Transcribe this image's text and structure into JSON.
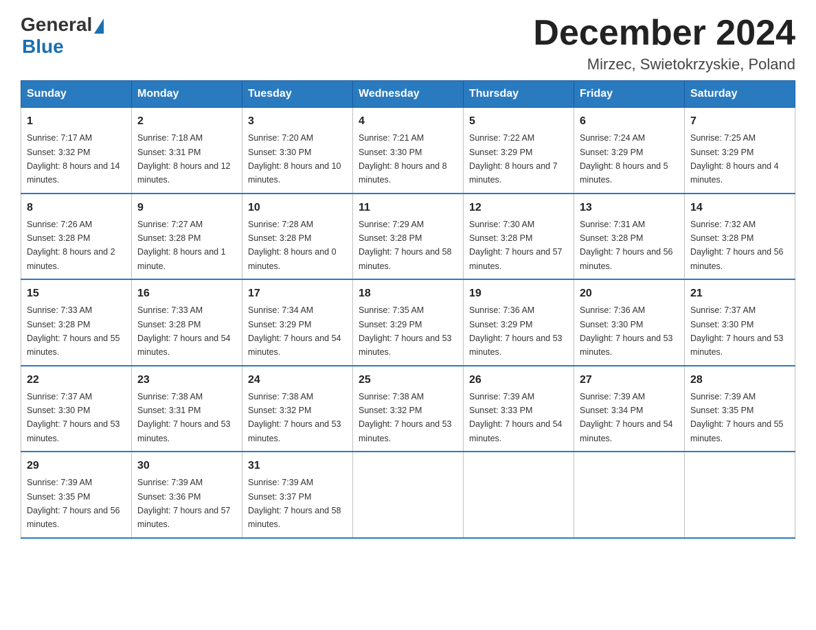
{
  "logo": {
    "general": "General",
    "blue": "Blue"
  },
  "title": "December 2024",
  "location": "Mirzec, Swietokrzyskie, Poland",
  "days_of_week": [
    "Sunday",
    "Monday",
    "Tuesday",
    "Wednesday",
    "Thursday",
    "Friday",
    "Saturday"
  ],
  "weeks": [
    [
      {
        "day": "1",
        "sunrise": "7:17 AM",
        "sunset": "3:32 PM",
        "daylight": "8 hours and 14 minutes."
      },
      {
        "day": "2",
        "sunrise": "7:18 AM",
        "sunset": "3:31 PM",
        "daylight": "8 hours and 12 minutes."
      },
      {
        "day": "3",
        "sunrise": "7:20 AM",
        "sunset": "3:30 PM",
        "daylight": "8 hours and 10 minutes."
      },
      {
        "day": "4",
        "sunrise": "7:21 AM",
        "sunset": "3:30 PM",
        "daylight": "8 hours and 8 minutes."
      },
      {
        "day": "5",
        "sunrise": "7:22 AM",
        "sunset": "3:29 PM",
        "daylight": "8 hours and 7 minutes."
      },
      {
        "day": "6",
        "sunrise": "7:24 AM",
        "sunset": "3:29 PM",
        "daylight": "8 hours and 5 minutes."
      },
      {
        "day": "7",
        "sunrise": "7:25 AM",
        "sunset": "3:29 PM",
        "daylight": "8 hours and 4 minutes."
      }
    ],
    [
      {
        "day": "8",
        "sunrise": "7:26 AM",
        "sunset": "3:28 PM",
        "daylight": "8 hours and 2 minutes."
      },
      {
        "day": "9",
        "sunrise": "7:27 AM",
        "sunset": "3:28 PM",
        "daylight": "8 hours and 1 minute."
      },
      {
        "day": "10",
        "sunrise": "7:28 AM",
        "sunset": "3:28 PM",
        "daylight": "8 hours and 0 minutes."
      },
      {
        "day": "11",
        "sunrise": "7:29 AM",
        "sunset": "3:28 PM",
        "daylight": "7 hours and 58 minutes."
      },
      {
        "day": "12",
        "sunrise": "7:30 AM",
        "sunset": "3:28 PM",
        "daylight": "7 hours and 57 minutes."
      },
      {
        "day": "13",
        "sunrise": "7:31 AM",
        "sunset": "3:28 PM",
        "daylight": "7 hours and 56 minutes."
      },
      {
        "day": "14",
        "sunrise": "7:32 AM",
        "sunset": "3:28 PM",
        "daylight": "7 hours and 56 minutes."
      }
    ],
    [
      {
        "day": "15",
        "sunrise": "7:33 AM",
        "sunset": "3:28 PM",
        "daylight": "7 hours and 55 minutes."
      },
      {
        "day": "16",
        "sunrise": "7:33 AM",
        "sunset": "3:28 PM",
        "daylight": "7 hours and 54 minutes."
      },
      {
        "day": "17",
        "sunrise": "7:34 AM",
        "sunset": "3:29 PM",
        "daylight": "7 hours and 54 minutes."
      },
      {
        "day": "18",
        "sunrise": "7:35 AM",
        "sunset": "3:29 PM",
        "daylight": "7 hours and 53 minutes."
      },
      {
        "day": "19",
        "sunrise": "7:36 AM",
        "sunset": "3:29 PM",
        "daylight": "7 hours and 53 minutes."
      },
      {
        "day": "20",
        "sunrise": "7:36 AM",
        "sunset": "3:30 PM",
        "daylight": "7 hours and 53 minutes."
      },
      {
        "day": "21",
        "sunrise": "7:37 AM",
        "sunset": "3:30 PM",
        "daylight": "7 hours and 53 minutes."
      }
    ],
    [
      {
        "day": "22",
        "sunrise": "7:37 AM",
        "sunset": "3:30 PM",
        "daylight": "7 hours and 53 minutes."
      },
      {
        "day": "23",
        "sunrise": "7:38 AM",
        "sunset": "3:31 PM",
        "daylight": "7 hours and 53 minutes."
      },
      {
        "day": "24",
        "sunrise": "7:38 AM",
        "sunset": "3:32 PM",
        "daylight": "7 hours and 53 minutes."
      },
      {
        "day": "25",
        "sunrise": "7:38 AM",
        "sunset": "3:32 PM",
        "daylight": "7 hours and 53 minutes."
      },
      {
        "day": "26",
        "sunrise": "7:39 AM",
        "sunset": "3:33 PM",
        "daylight": "7 hours and 54 minutes."
      },
      {
        "day": "27",
        "sunrise": "7:39 AM",
        "sunset": "3:34 PM",
        "daylight": "7 hours and 54 minutes."
      },
      {
        "day": "28",
        "sunrise": "7:39 AM",
        "sunset": "3:35 PM",
        "daylight": "7 hours and 55 minutes."
      }
    ],
    [
      {
        "day": "29",
        "sunrise": "7:39 AM",
        "sunset": "3:35 PM",
        "daylight": "7 hours and 56 minutes."
      },
      {
        "day": "30",
        "sunrise": "7:39 AM",
        "sunset": "3:36 PM",
        "daylight": "7 hours and 57 minutes."
      },
      {
        "day": "31",
        "sunrise": "7:39 AM",
        "sunset": "3:37 PM",
        "daylight": "7 hours and 58 minutes."
      },
      null,
      null,
      null,
      null
    ]
  ]
}
